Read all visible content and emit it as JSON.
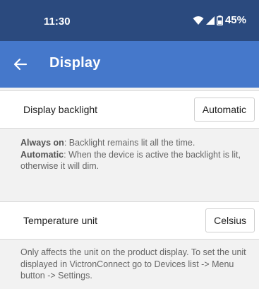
{
  "status_bar": {
    "time": "11:30",
    "battery_percent": "45%",
    "icons": [
      "wifi-icon",
      "signal-icon",
      "battery-icon"
    ]
  },
  "app_bar": {
    "title": "Display",
    "back_icon": "arrow-left-icon",
    "color": "#4578cb"
  },
  "settings": [
    {
      "label": "Display backlight",
      "value": "Automatic",
      "description": [
        {
          "bold": "Always on",
          "text": ": Backlight remains lit all the time."
        },
        {
          "bold": "Automatic",
          "text": ": When the device is active the backlight is lit, otherwise it will dim."
        }
      ]
    },
    {
      "label": "Temperature unit",
      "value": "Celsius",
      "description_text": "Only affects the unit on the product display. To set the unit displayed in VictronConnect go to Devices list -> Menu button -> Settings."
    }
  ]
}
